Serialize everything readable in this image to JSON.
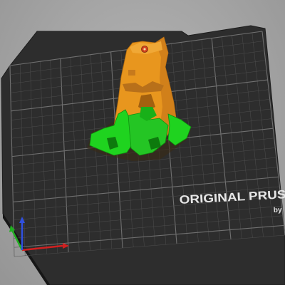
{
  "viewport": {
    "bed_brand_text": "ORIGINAL PRUS",
    "bed_brand_sub": "by",
    "background_color": "#a3a3a3",
    "bed_color": "#2b2b2b",
    "grid_color": "#5a5a5a",
    "model_color": "#e8961e",
    "support_color": "#1fd31f",
    "axis_x_color": "#d02020",
    "axis_y_color": "#20b020",
    "axis_z_color": "#3050e0"
  }
}
